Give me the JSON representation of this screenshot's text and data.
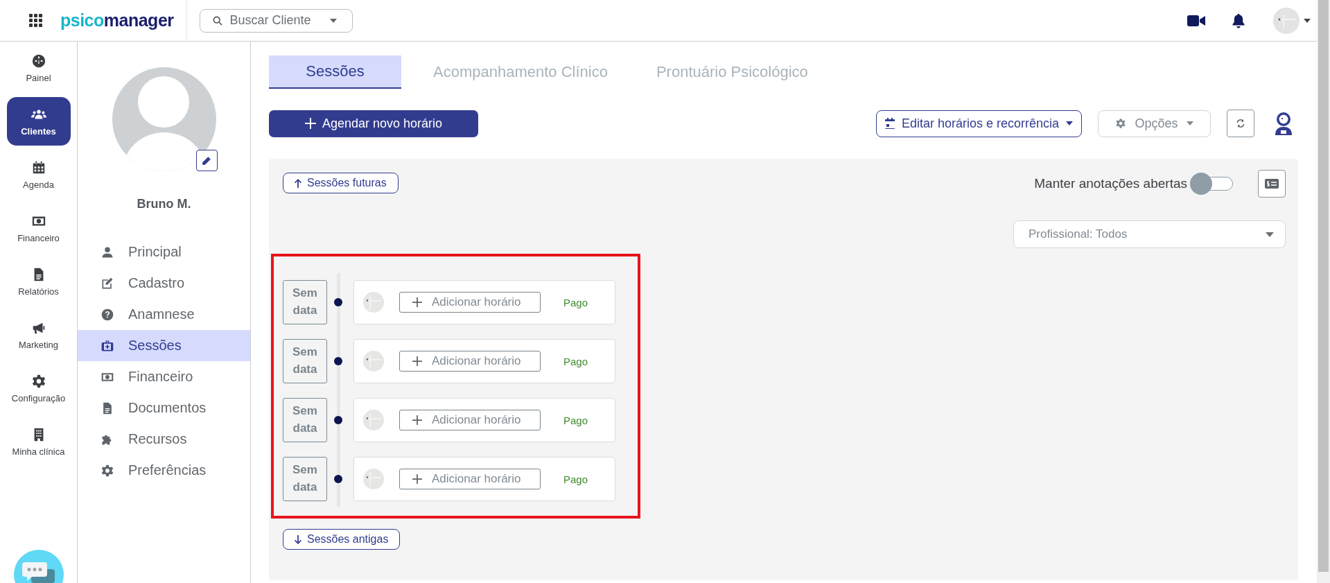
{
  "top_bar": {
    "logo_parts": [
      "psico",
      "manager"
    ],
    "search": {
      "placeholder": "Buscar Cliente"
    }
  },
  "nav": [
    {
      "label": "Painel",
      "selected": false
    },
    {
      "label": "Clientes",
      "selected": true
    },
    {
      "label": "Agenda",
      "selected": false
    },
    {
      "label": "Financeiro",
      "selected": false
    },
    {
      "label": "Relatórios",
      "selected": false
    },
    {
      "label": "Marketing",
      "selected": false
    },
    {
      "label": "Configuração",
      "selected": false
    },
    {
      "label": "Minha clínica",
      "selected": false
    }
  ],
  "client": {
    "name": "Bruno M."
  },
  "client_menu": [
    {
      "label": "Principal",
      "selected": false
    },
    {
      "label": "Cadastro",
      "selected": false
    },
    {
      "label": "Anamnese",
      "selected": false
    },
    {
      "label": "Sessões",
      "selected": true
    },
    {
      "label": "Financeiro",
      "selected": false
    },
    {
      "label": "Documentos",
      "selected": false
    },
    {
      "label": "Recursos",
      "selected": false
    },
    {
      "label": "Preferências",
      "selected": false
    }
  ],
  "tabs": [
    {
      "label": "Sessões",
      "selected": true
    },
    {
      "label": "Acompanhamento Clínico",
      "selected": false
    },
    {
      "label": "Prontuário Psicológico",
      "selected": false
    }
  ],
  "actions": {
    "schedule": "Agendar novo horário",
    "edit": "Editar horários e recorrência",
    "options": "Opções"
  },
  "sessions_panel": {
    "future": "Sessões futuras",
    "past": "Sessões antigas",
    "keep_notes": {
      "label": "Manter anotações abertas",
      "on": false
    },
    "professional_filter": "Profissional: Todos",
    "sessions": [
      {
        "date": "Sem data",
        "add": "Adicionar horário",
        "status": "Pago"
      },
      {
        "date": "Sem data",
        "add": "Adicionar horário",
        "status": "Pago"
      },
      {
        "date": "Sem data",
        "add": "Adicionar horário",
        "status": "Pago"
      },
      {
        "date": "Sem data",
        "add": "Adicionar horário",
        "status": "Pago"
      }
    ]
  }
}
